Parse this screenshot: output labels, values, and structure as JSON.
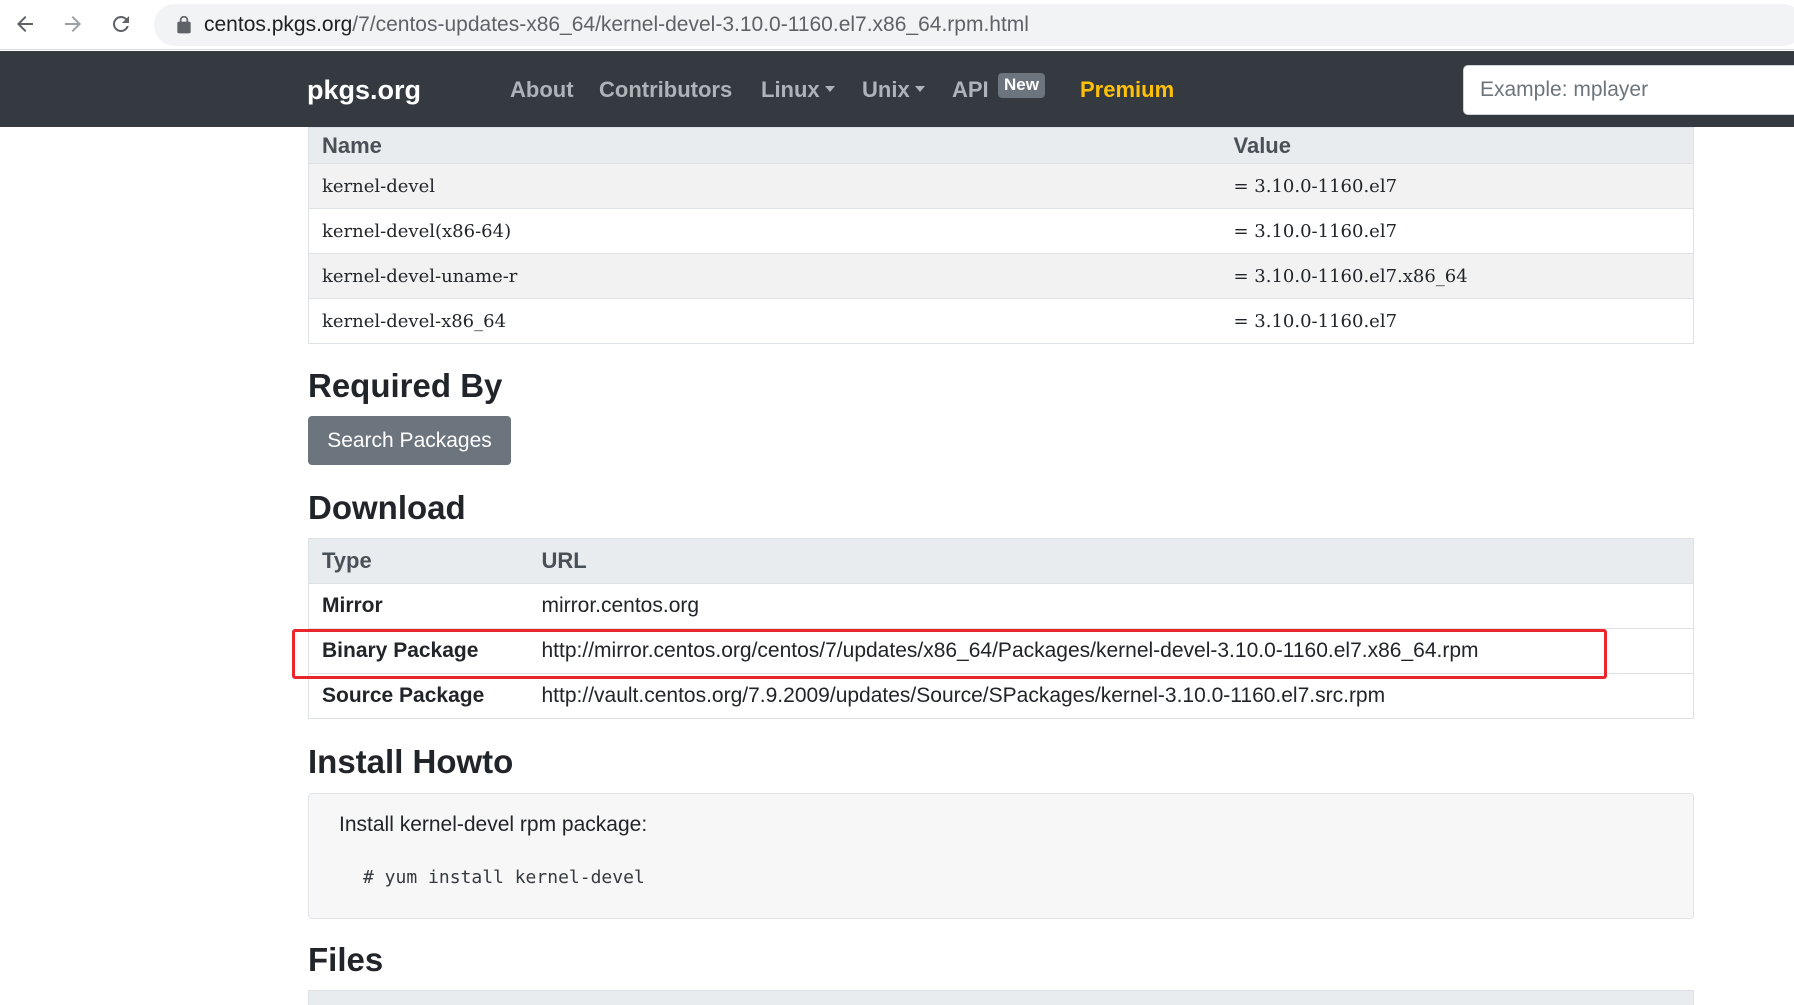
{
  "browser": {
    "url_host": "centos.pkgs.org",
    "url_path": "/7/centos-updates-x86_64/kernel-devel-3.10.0-1160.el7.x86_64.rpm.html"
  },
  "navbar": {
    "brand": "pkgs.org",
    "links": {
      "about": "About",
      "contributors": "Contributors",
      "linux": "Linux",
      "unix": "Unix",
      "api": "API",
      "api_badge": "New",
      "premium": "Premium"
    },
    "search_placeholder": "Example: mplayer",
    "colors": {
      "background": "#343a40",
      "premium": "#ffc107"
    }
  },
  "provides": {
    "headers": {
      "name": "Name",
      "value": "Value"
    },
    "rows": [
      {
        "name": "kernel-devel",
        "value": "= 3.10.0-1160.el7"
      },
      {
        "name": "kernel-devel(x86-64)",
        "value": "= 3.10.0-1160.el7"
      },
      {
        "name": "kernel-devel-uname-r",
        "value": "= 3.10.0-1160.el7.x86_64"
      },
      {
        "name": "kernel-devel-x86_64",
        "value": "= 3.10.0-1160.el7"
      }
    ]
  },
  "required_by": {
    "title": "Required By",
    "button": "Search Packages"
  },
  "download": {
    "title": "Download",
    "headers": {
      "type": "Type",
      "url": "URL"
    },
    "rows": [
      {
        "type": "Mirror",
        "url": "mirror.centos.org"
      },
      {
        "type": "Binary Package",
        "url": "http://mirror.centos.org/centos/7/updates/x86_64/Packages/kernel-devel-3.10.0-1160.el7.x86_64.rpm"
      },
      {
        "type": "Source Package",
        "url": "http://vault.centos.org/7.9.2009/updates/Source/SPackages/kernel-3.10.0-1160.el7.src.rpm"
      }
    ],
    "highlight_color": "#e8262c"
  },
  "install_howto": {
    "title": "Install Howto",
    "description": "Install kernel-devel rpm package:",
    "command": "# yum install kernel-devel"
  },
  "files": {
    "title": "Files"
  }
}
